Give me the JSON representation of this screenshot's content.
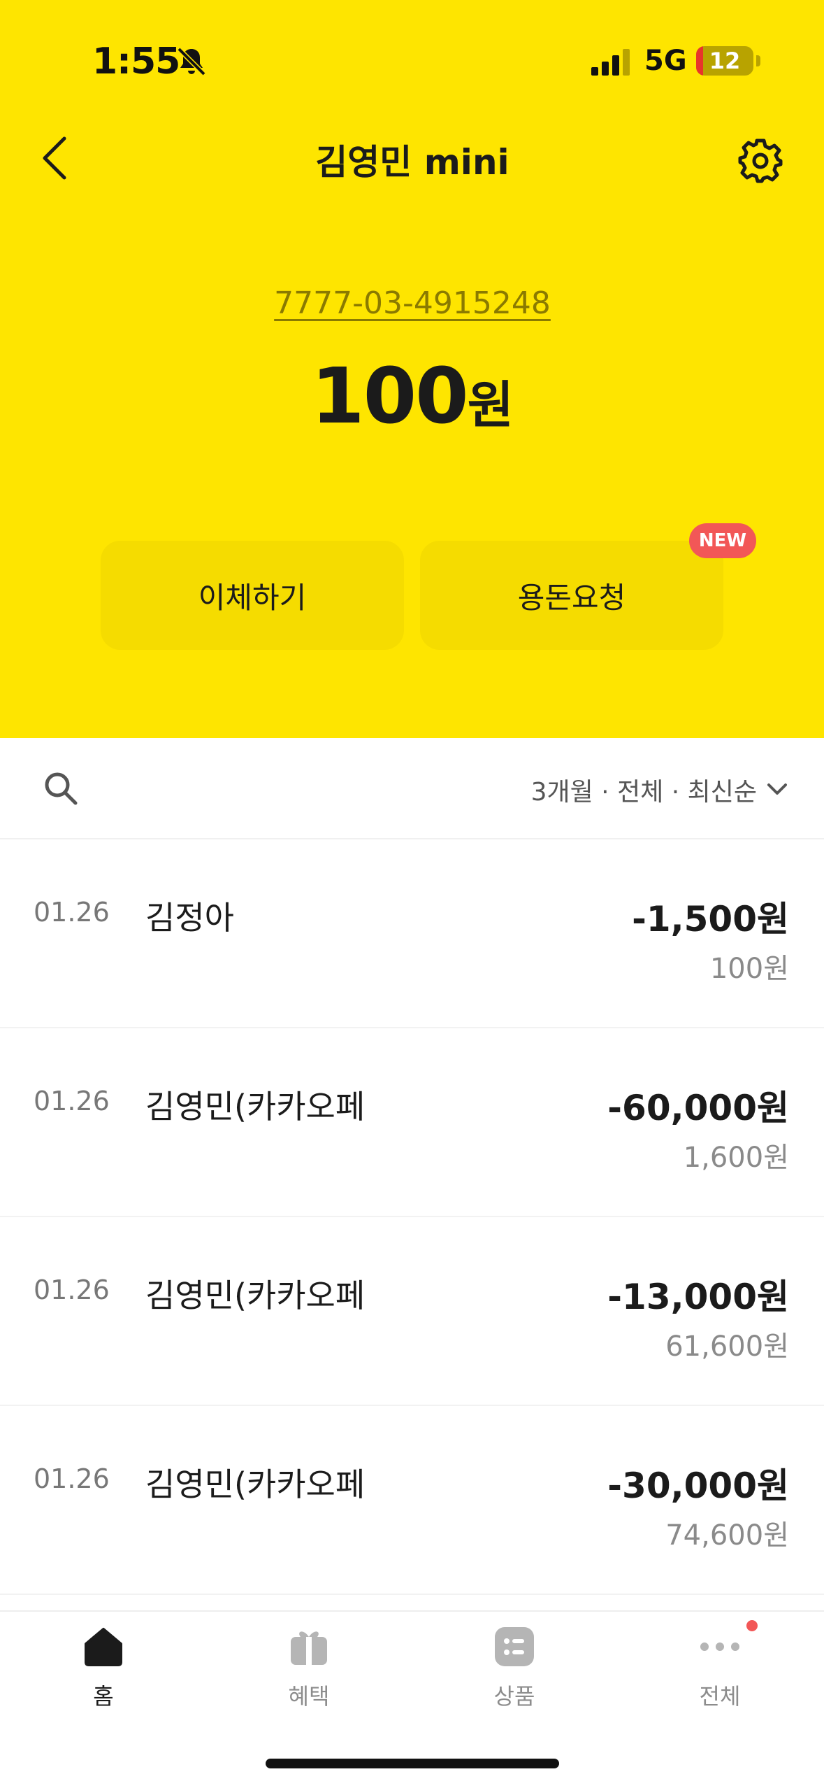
{
  "status_bar": {
    "time": "1:55",
    "network": "5G",
    "battery": "12",
    "battery_level_percent": 12
  },
  "nav": {
    "title": "김영민 mini"
  },
  "account": {
    "number": "7777-03-4915248",
    "balance_amount": "100",
    "balance_unit": "원"
  },
  "actions": {
    "transfer_label": "이체하기",
    "allowance_label": "용돈요청",
    "new_badge": "NEW"
  },
  "filter": {
    "label": "3개월 · 전체 · 최신순"
  },
  "transactions": [
    {
      "date": "01.26",
      "name": "김정아",
      "amount": "-1,500원",
      "balance": "100원"
    },
    {
      "date": "01.26",
      "name": "김영민(카카오페",
      "amount": "-60,000원",
      "balance": "1,600원"
    },
    {
      "date": "01.26",
      "name": "김영민(카카오페",
      "amount": "-13,000원",
      "balance": "61,600원"
    },
    {
      "date": "01.26",
      "name": "김영민(카카오페",
      "amount": "-30,000원",
      "balance": "74,600원"
    }
  ],
  "tabs": [
    {
      "label": "홈",
      "icon": "home-icon",
      "active": true
    },
    {
      "label": "혜택",
      "icon": "gift-icon",
      "active": false
    },
    {
      "label": "상품",
      "icon": "list-icon",
      "active": false
    },
    {
      "label": "전체",
      "icon": "more-icon",
      "active": false
    }
  ],
  "colors": {
    "brand_yellow": "#FEE500",
    "button_yellow": "#F5DC00",
    "badge_red": "#F25757"
  }
}
